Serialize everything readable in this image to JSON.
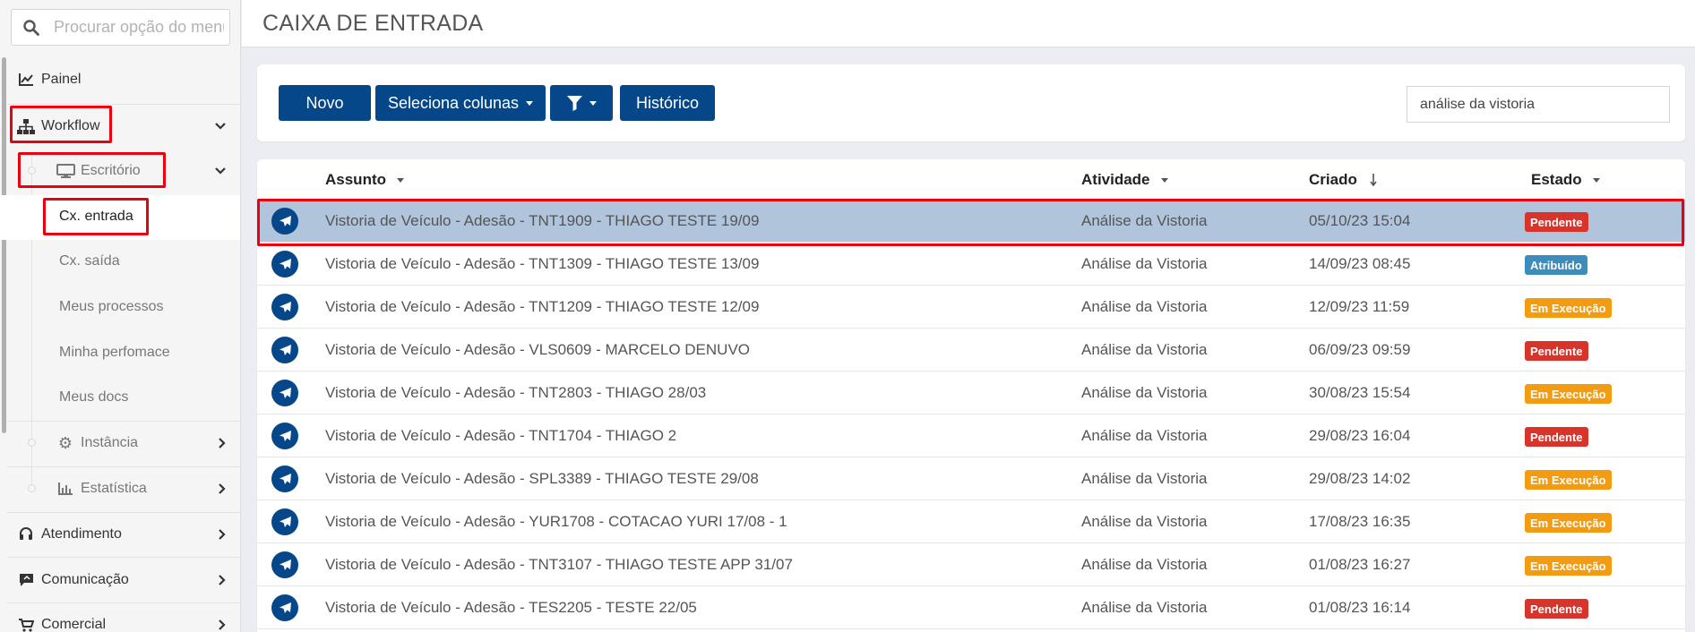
{
  "sidebar": {
    "search_placeholder": "Procurar opção do menu",
    "items": {
      "painel": "Painel",
      "workflow": "Workflow",
      "escritorio": "Escritório",
      "cx_entrada": "Cx. entrada",
      "cx_saida": "Cx. saída",
      "meus_processos": "Meus processos",
      "minha_performance": "Minha perfomace",
      "meus_docs": "Meus docs",
      "instancia": "Instância",
      "estatistica": "Estatística",
      "atendimento": "Atendimento",
      "comunicacao": "Comunicação",
      "comercial": "Comercial"
    }
  },
  "header": {
    "title": "CAIXA DE ENTRADA"
  },
  "toolbar": {
    "novo": "Novo",
    "seleciona_colunas": "Seleciona colunas",
    "historico": "Histórico",
    "filter_value": "análise da vistoria"
  },
  "table": {
    "headers": {
      "assunto": "Assunto",
      "atividade": "Atividade",
      "criado": "Criado",
      "estado": "Estado"
    },
    "rows": [
      {
        "assunto": "Vistoria de Veículo - Adesão - TNT1909 - THIAGO TESTE 19/09",
        "atividade": "Análise da Vistoria",
        "criado": "05/10/23 15:04",
        "estado": "Pendente",
        "color": "#d9342b",
        "selected": true
      },
      {
        "assunto": "Vistoria de Veículo - Adesão - TNT1309 - THIAGO TESTE 13/09",
        "atividade": "Análise da Vistoria",
        "criado": "14/09/23 08:45",
        "estado": "Atribuído",
        "color": "#3c8dbc"
      },
      {
        "assunto": "Vistoria de Veículo - Adesão - TNT1209 - THIAGO TESTE 12/09",
        "atividade": "Análise da Vistoria",
        "criado": "12/09/23 11:59",
        "estado": "Em Execução",
        "color": "#f39c12"
      },
      {
        "assunto": "Vistoria de Veículo - Adesão - VLS0609 - MARCELO DENUVO",
        "atividade": "Análise da Vistoria",
        "criado": "06/09/23 09:59",
        "estado": "Pendente",
        "color": "#d9342b"
      },
      {
        "assunto": "Vistoria de Veículo - Adesão - TNT2803 - THIAGO 28/03",
        "atividade": "Análise da Vistoria",
        "criado": "30/08/23 15:54",
        "estado": "Em Execução",
        "color": "#f39c12"
      },
      {
        "assunto": "Vistoria de Veículo - Adesão - TNT1704 - THIAGO 2",
        "atividade": "Análise da Vistoria",
        "criado": "29/08/23 16:04",
        "estado": "Pendente",
        "color": "#d9342b"
      },
      {
        "assunto": "Vistoria de Veículo - Adesão - SPL3389 - THIAGO TESTE 29/08",
        "atividade": "Análise da Vistoria",
        "criado": "29/08/23 14:02",
        "estado": "Em Execução",
        "color": "#f39c12"
      },
      {
        "assunto": "Vistoria de Veículo - Adesão - YUR1708 - COTACAO YURI 17/08 - 1",
        "atividade": "Análise da Vistoria",
        "criado": "17/08/23 16:35",
        "estado": "Em Execução",
        "color": "#f39c12"
      },
      {
        "assunto": "Vistoria de Veículo - Adesão - TNT3107 - THIAGO TESTE APP 31/07",
        "atividade": "Análise da Vistoria",
        "criado": "01/08/23 16:27",
        "estado": "Em Execução",
        "color": "#f39c12"
      },
      {
        "assunto": "Vistoria de Veículo - Adesão - TES2205 - TESTE 22/05",
        "atividade": "Análise da Vistoria",
        "criado": "01/08/23 16:14",
        "estado": "Pendente",
        "color": "#d9342b"
      }
    ]
  },
  "colors": {
    "primary": "#064789",
    "highlight": "#e8000f",
    "selected_row": "#b0c4dc"
  }
}
